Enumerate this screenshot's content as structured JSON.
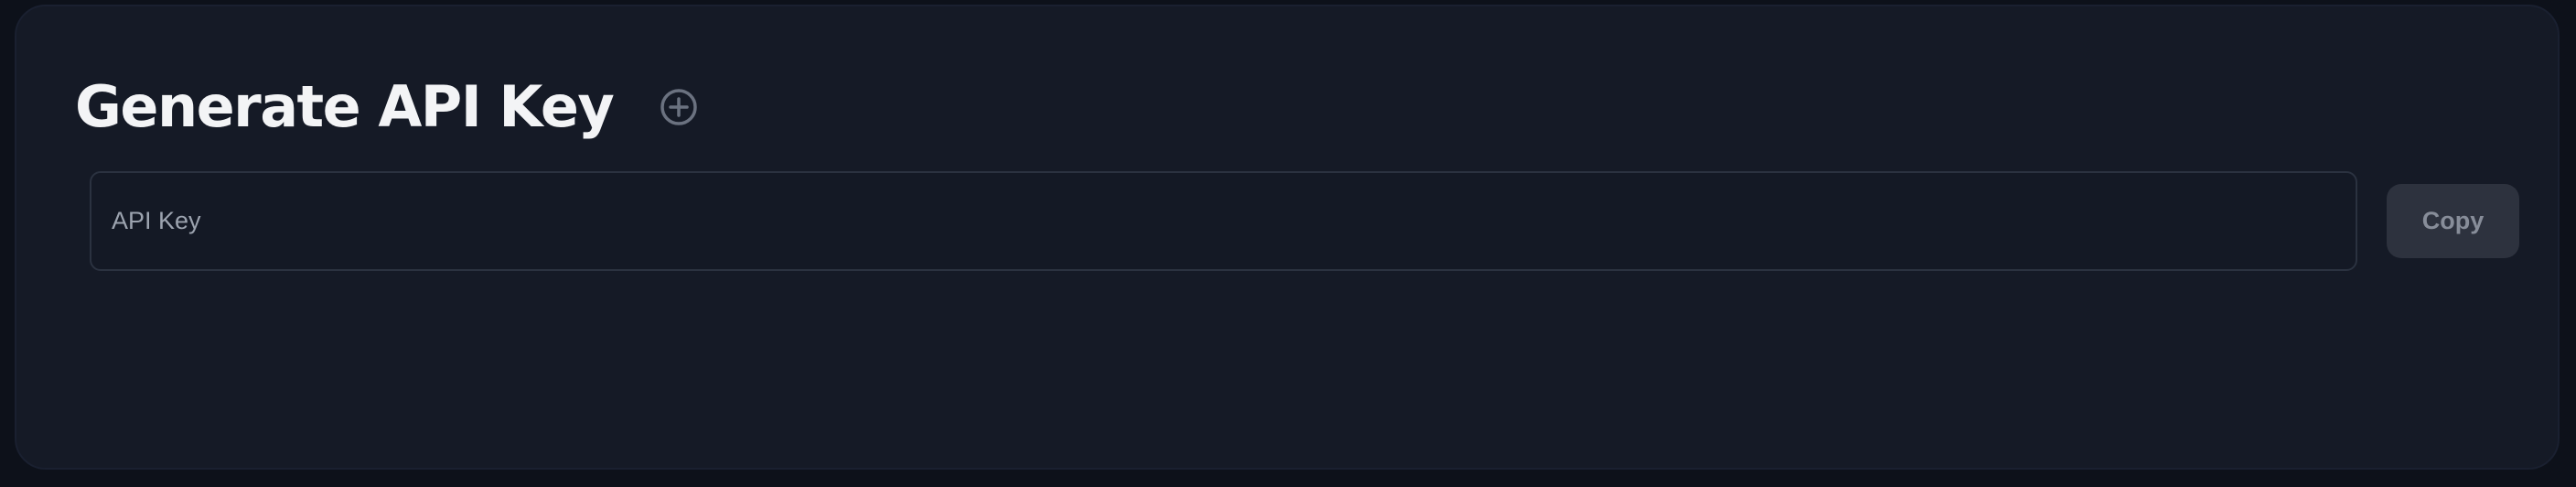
{
  "card": {
    "title": "Generate API Key",
    "add_icon": "plus-circle-icon"
  },
  "api_key": {
    "value": "",
    "placeholder": "API Key"
  },
  "copy_button": {
    "label": "Copy"
  }
}
